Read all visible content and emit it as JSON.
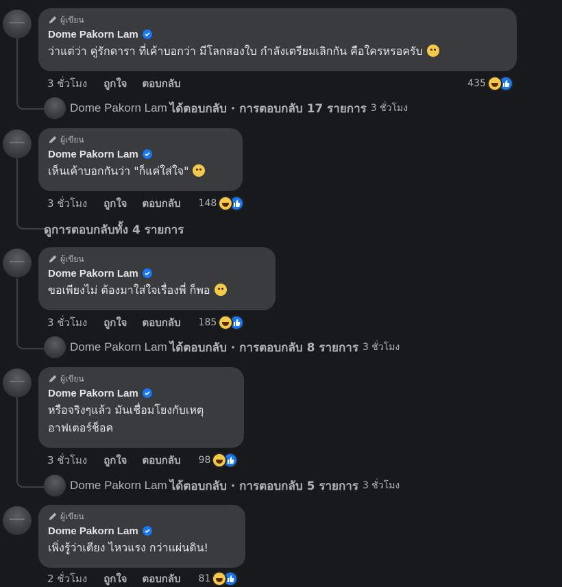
{
  "author_badge_label": "ผู้เขียน",
  "comments": [
    {
      "name": "Dome Pakorn Lam",
      "text": "ว่าแต่ว่า คู่รักดารา ที่เค้าบอกว่า มีโลกสองใบ กำลังเตรียมเลิกกัน คือใครหรอครับ",
      "emoji": "face-with-monocle",
      "time": "3 ชั่วโมง",
      "like": "ถูกใจ",
      "reply": "ตอบกลับ",
      "reactions": "435",
      "reply_summary": {
        "name": "Dome Pakorn Lam",
        "text": "ได้ตอบกลับ · การตอบกลับ 17 รายการ",
        "time": "3 ชั่วโมง"
      }
    },
    {
      "name": "Dome Pakorn Lam",
      "text": "เห็นเค้าบอกกันว่า \"ก็แค่ใส่ใจ\"",
      "emoji": "face-rolling-eyes",
      "time": "3 ชั่วโมง",
      "like": "ถูกใจ",
      "reply": "ตอบกลับ",
      "reactions": "148",
      "view_all": "ดูการตอบกลับทั้ง 4 รายการ"
    },
    {
      "name": "Dome Pakorn Lam",
      "text": "ขอเพียงไม่ ต้องมาใส่ใจเรื่องพี่ ก็พอ",
      "emoji": "grinning-sweat",
      "time": "3 ชั่วโมง",
      "like": "ถูกใจ",
      "reply": "ตอบกลับ",
      "reactions": "185",
      "reply_summary": {
        "name": "Dome Pakorn Lam",
        "text": "ได้ตอบกลับ · การตอบกลับ 8 รายการ",
        "time": "3 ชั่วโมง"
      }
    },
    {
      "name": "Dome Pakorn Lam",
      "text_line1": "หรือจริงๆแล้ว มันเชื่อมโยงกับเหตุ",
      "text_line2": "อาฟเตอร์ช็อค",
      "time": "3 ชั่วโมง",
      "like": "ถูกใจ",
      "reply": "ตอบกลับ",
      "reactions": "98",
      "reply_summary": {
        "name": "Dome Pakorn Lam",
        "text": "ได้ตอบกลับ · การตอบกลับ 5 รายการ",
        "time": "3 ชั่วโมง"
      }
    },
    {
      "name": "Dome Pakorn Lam",
      "text": "เพิ่งรู้ว่าเตียง ไหวแรง กว่าแผ่นดิน!",
      "time": "2 ชั่วโมง",
      "like": "ถูกใจ",
      "reply": "ตอบกลับ",
      "reactions": "81"
    }
  ],
  "colors": {
    "background": "#18191a",
    "bubble": "#3a3b3c",
    "verified": "#1877f2",
    "muted": "#b0b3b8"
  }
}
